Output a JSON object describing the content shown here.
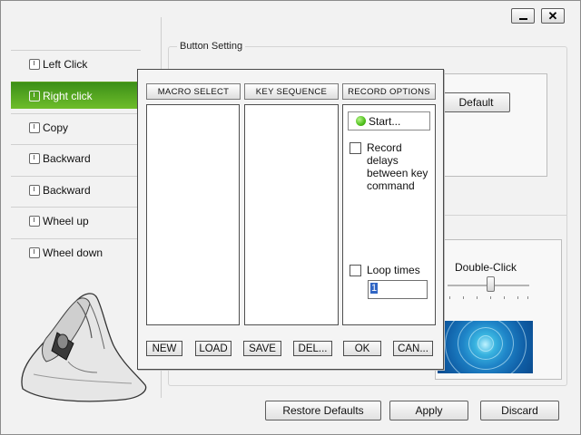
{
  "window": {
    "controls": {
      "minimize_icon": "minimize-icon",
      "close_label": "✕"
    }
  },
  "sidebar": {
    "items": [
      {
        "label": "Left Click",
        "icon": "mouse-button-icon",
        "active": false
      },
      {
        "label": "Right click",
        "icon": "mouse-button-icon",
        "active": true
      },
      {
        "label": "Copy",
        "icon": "mouse-button-icon",
        "active": false
      },
      {
        "label": "Backward",
        "icon": "mouse-button-icon",
        "active": false
      },
      {
        "label": "Backward",
        "icon": "mouse-button-icon",
        "active": false
      },
      {
        "label": "Wheel up",
        "icon": "mouse-button-icon",
        "active": false
      },
      {
        "label": "Wheel down",
        "icon": "mouse-button-icon",
        "active": false
      }
    ],
    "active_color": "#4fa21e"
  },
  "button_setting": {
    "legend": "Button Setting",
    "default_label": "Default",
    "double_click_label": "Double-Click",
    "double_click_level": 0.5
  },
  "macro_dialog": {
    "headers": {
      "macro_select": "MACRO SELECT",
      "key_sequence": "KEY SEQUENCE",
      "record_options": "RECORD OPTIONS"
    },
    "start_label": "Start...",
    "start_icon": "green-dot-icon",
    "record_delays_label": "Record delays between key command",
    "record_delays_checked": false,
    "loop_times_label": "Loop times",
    "loop_times_checked": false,
    "loop_times_value": "1",
    "buttons": {
      "new": "NEW",
      "load": "LOAD",
      "save": "SAVE",
      "del": "DEL...",
      "ok": "OK",
      "can": "CAN..."
    }
  },
  "footer": {
    "restore_label": "Restore Defaults",
    "apply_label": "Apply",
    "discard_label": "Discard"
  }
}
